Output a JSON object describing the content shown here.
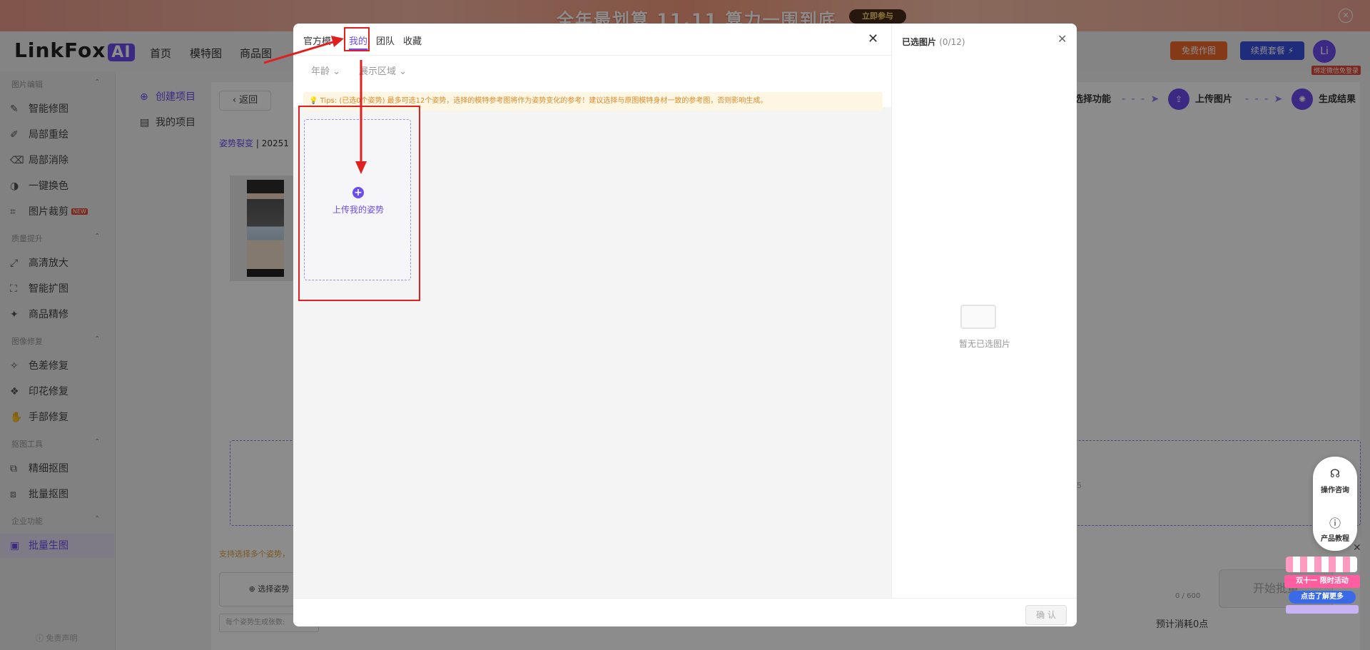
{
  "banner": {
    "promo_text": "全年最划算 11.11 算力一围到底",
    "cta": "立即参与",
    "close": "✕"
  },
  "topnav": {
    "logo_main": "LinkFox",
    "logo_ai": "AI",
    "links": [
      "首页",
      "模特图",
      "商品图"
    ],
    "free_btn": "免费作图",
    "renew_btn": "续费套餐 ⚡",
    "avatar": "Li",
    "bind_tag": "绑定微信免登录"
  },
  "sidebar": {
    "sections": [
      {
        "title": "图片编辑",
        "items": [
          {
            "label": "智能修图",
            "icon": "✎"
          },
          {
            "label": "局部重绘",
            "icon": "✐"
          },
          {
            "label": "局部消除",
            "icon": "⌫"
          },
          {
            "label": "一键换色",
            "icon": "◑"
          },
          {
            "label": "图片裁剪",
            "icon": "⌗",
            "badge": "NEW"
          }
        ]
      },
      {
        "title": "质量提升",
        "items": [
          {
            "label": "高清放大",
            "icon": "⤢"
          },
          {
            "label": "智能扩图",
            "icon": "⛶"
          },
          {
            "label": "商品精修",
            "icon": "✦"
          }
        ]
      },
      {
        "title": "图像修复",
        "items": [
          {
            "label": "色差修复",
            "icon": "✧"
          },
          {
            "label": "印花修复",
            "icon": "❖"
          },
          {
            "label": "手部修复",
            "icon": "✋"
          }
        ]
      },
      {
        "title": "抠图工具",
        "items": [
          {
            "label": "精细抠图",
            "icon": "⧉"
          },
          {
            "label": "批量抠图",
            "icon": "⧈"
          }
        ]
      },
      {
        "title": "企业功能",
        "items": [
          {
            "label": "批量生图",
            "icon": "▣"
          }
        ]
      }
    ],
    "disclaimer": "ⓘ 免责声明"
  },
  "projects": {
    "create": "创建项目",
    "mine": "我的项目"
  },
  "work": {
    "back": "返回",
    "crumb_link": "姿势裂变",
    "crumb_sep": "|",
    "crumb_rest": "20251",
    "tip": "支持选择多个姿势，",
    "pose_btn": "⊕ 选择姿势",
    "count_placeholder": "每个姿势生成张数: ",
    "char_count": "0 / 600",
    "start_btn": "开始批量",
    "cost": "预计消耗0点",
    "right_partial": "5",
    "steps": [
      "选择功能",
      "上传图片",
      "生成结果"
    ]
  },
  "modal": {
    "tabs": [
      "官方模",
      "我的",
      "团队",
      "收藏"
    ],
    "active_tab": "我的",
    "close": "✕",
    "filters": [
      "年龄",
      "展示区域"
    ],
    "tips": "💡 Tips: (已选0个姿势) 最多可选12个姿势，选择的模特参考图将作为姿势变化的参考！建议选择与原图模特身材一致的参考图，否则影响生成。",
    "upload_label": "上传我的姿势",
    "right_title": "已选图片",
    "right_count": "(0/12)",
    "empty_text": "暂无已选图片",
    "confirm": "确 认"
  },
  "float": {
    "consult": "操作咨询",
    "tutorial": "产品教程",
    "promo1": "双十一 限时活动",
    "promo2": "点击了解更多"
  },
  "colors": {
    "accent": "#6c4bf0",
    "annotation": "#e02020"
  }
}
